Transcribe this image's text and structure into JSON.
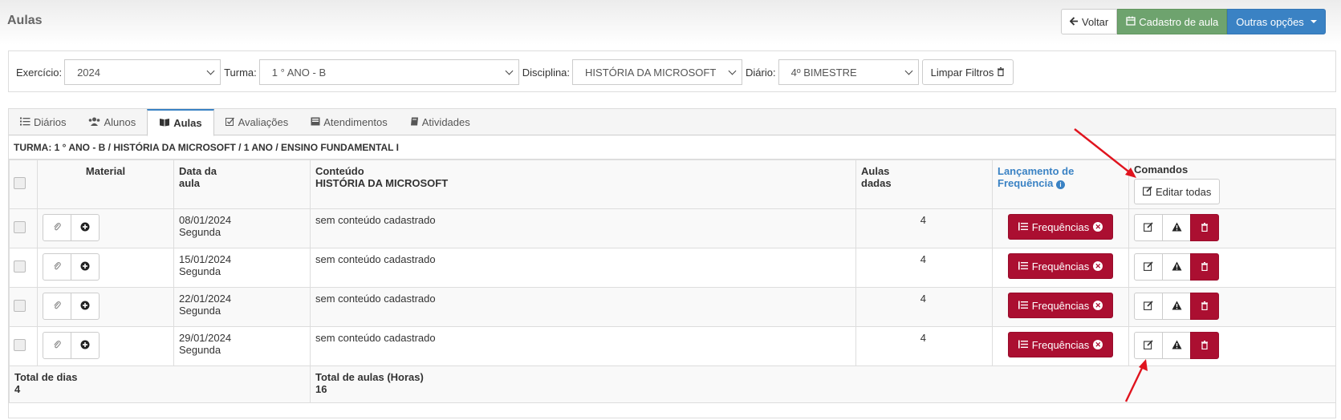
{
  "page": {
    "title": "Aulas"
  },
  "top_actions": {
    "voltar": "Voltar",
    "cadastro": "Cadastro de aula",
    "outras": "Outras opções"
  },
  "filters": {
    "exercicio_label": "Exercício:",
    "exercicio_value": "2024",
    "turma_label": "Turma:",
    "turma_value": "1 ° ANO - B",
    "disciplina_label": "Disciplina:",
    "disciplina_value": "HISTÓRIA DA MICROSOFT",
    "diario_label": "Diário:",
    "diario_value": "4º BIMESTRE",
    "limpar_label": "Limpar Filtros"
  },
  "tabs": [
    {
      "label": "Diários",
      "icon": "list-icon",
      "active": false
    },
    {
      "label": "Alunos",
      "icon": "users-icon",
      "active": false
    },
    {
      "label": "Aulas",
      "icon": "book-icon",
      "active": true
    },
    {
      "label": "Avaliações",
      "icon": "checkbox-edit-icon",
      "active": false
    },
    {
      "label": "Atendimentos",
      "icon": "inbox-icon",
      "active": false
    },
    {
      "label": "Atividades",
      "icon": "book-open-icon",
      "active": false
    }
  ],
  "turma_line": "TURMA: 1 ° ANO - B / HISTÓRIA DA MICROSOFT / 1 ANO / ENSINO FUNDAMENTAL I",
  "table": {
    "col_material": "Material",
    "col_data_1": "Data da",
    "col_data_2": "aula",
    "col_conteudo_1": "Conteúdo",
    "col_conteudo_2": "HISTÓRIA DA MICROSOFT",
    "col_aulas_1": "Aulas",
    "col_aulas_2": "dadas",
    "col_freq_1": "Lançamento de",
    "col_freq_2": "Frequência",
    "col_comandos": "Comandos",
    "editar_todas": "Editar todas",
    "freq_button": "Frequências",
    "rows": [
      {
        "date": "08/01/2024",
        "weekday": "Segunda",
        "content": "sem conteúdo cadastrado",
        "aulas": "4"
      },
      {
        "date": "15/01/2024",
        "weekday": "Segunda",
        "content": "sem conteúdo cadastrado",
        "aulas": "4"
      },
      {
        "date": "22/01/2024",
        "weekday": "Segunda",
        "content": "sem conteúdo cadastrado",
        "aulas": "4"
      },
      {
        "date": "29/01/2024",
        "weekday": "Segunda",
        "content": "sem conteúdo cadastrado",
        "aulas": "4"
      }
    ],
    "total_dias_label": "Total de dias",
    "total_dias_value": "4",
    "total_aulas_label": "Total de aulas (Horas)",
    "total_aulas_value": "16"
  },
  "colors": {
    "danger": "#ab0f31",
    "primary": "#3a82c4",
    "success": "#6ea36e",
    "annotation_arrow": "#e0141e"
  }
}
